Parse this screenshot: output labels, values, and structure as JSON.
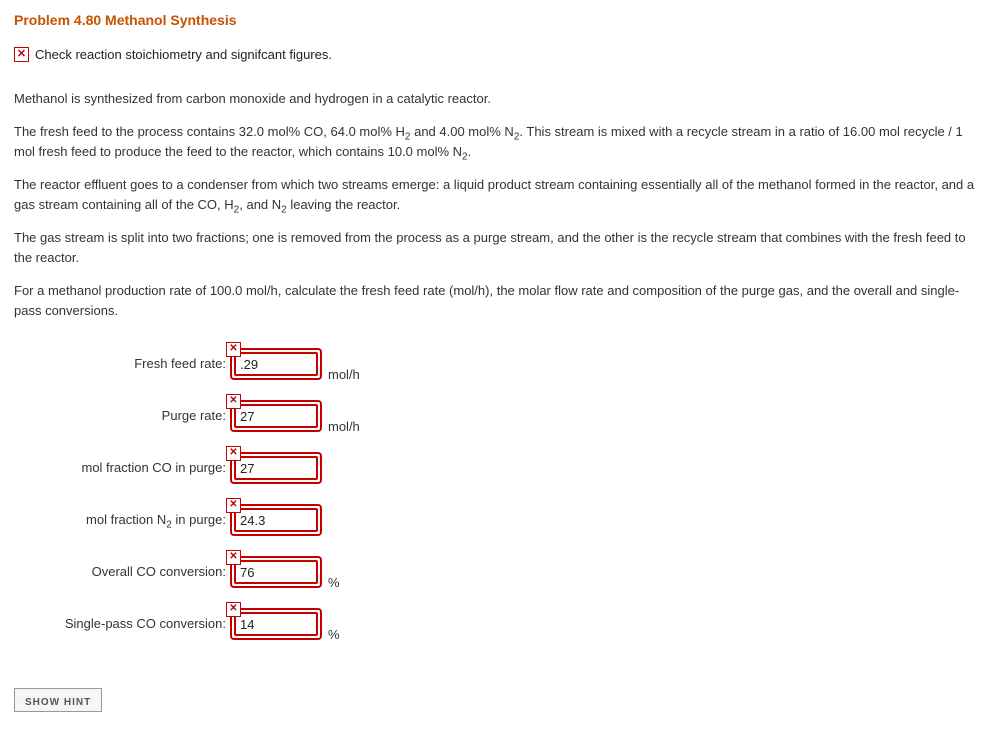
{
  "title": "Problem 4.80 Methanol Synthesis",
  "feedback": {
    "message": "Check reaction stoichiometry and signifcant figures."
  },
  "paragraphs": {
    "p1": "Methanol is synthesized from carbon monoxide and hydrogen in a catalytic reactor.",
    "p2_a": "The fresh feed to the process contains 32.0 mol% CO, 64.0 mol% H",
    "p2_b": " and 4.00 mol% N",
    "p2_c": ". This stream is mixed with a recycle stream in a ratio of 16.00 mol recycle / 1 mol fresh feed to produce the feed to the reactor, which contains 10.0 mol% N",
    "p2_d": ".",
    "p3_a": "The reactor effluent goes to a condenser from which two streams emerge: a liquid product stream containing essentially all of the methanol formed in the reactor, and a gas stream containing all of the CO, H",
    "p3_b": ", and N",
    "p3_c": " leaving the reactor.",
    "p4": "The gas stream is split into two fractions; one is removed from the process as a purge stream, and the other is the recycle stream that combines with the fresh feed to the reactor.",
    "p5": "For a methanol production rate of 100.0 mol/h, calculate the fresh feed rate (mol/h), the molar flow rate and composition of the purge gas, and the overall and single-pass conversions."
  },
  "answers": [
    {
      "label": "Fresh feed rate:",
      "value": ".29",
      "unit": "mol/h",
      "name": "fresh-feed-rate"
    },
    {
      "label": "Purge rate:",
      "value": "27",
      "unit": "mol/h",
      "name": "purge-rate"
    },
    {
      "label": "mol fraction CO in purge:",
      "value": "27",
      "unit": "",
      "name": "mol-fraction-co"
    },
    {
      "label_html": "mol fraction N<sub>2</sub> in purge:",
      "label": "mol fraction N2 in purge:",
      "value": "24.3",
      "unit": "",
      "name": "mol-fraction-n2"
    },
    {
      "label": "Overall CO conversion:",
      "value": "76",
      "unit": "%",
      "name": "overall-co-conversion"
    },
    {
      "label": "Single-pass CO conversion:",
      "value": "14",
      "unit": "%",
      "name": "single-pass-co-conversion"
    }
  ],
  "hint_button": "SHOW HINT",
  "sub2": "2"
}
